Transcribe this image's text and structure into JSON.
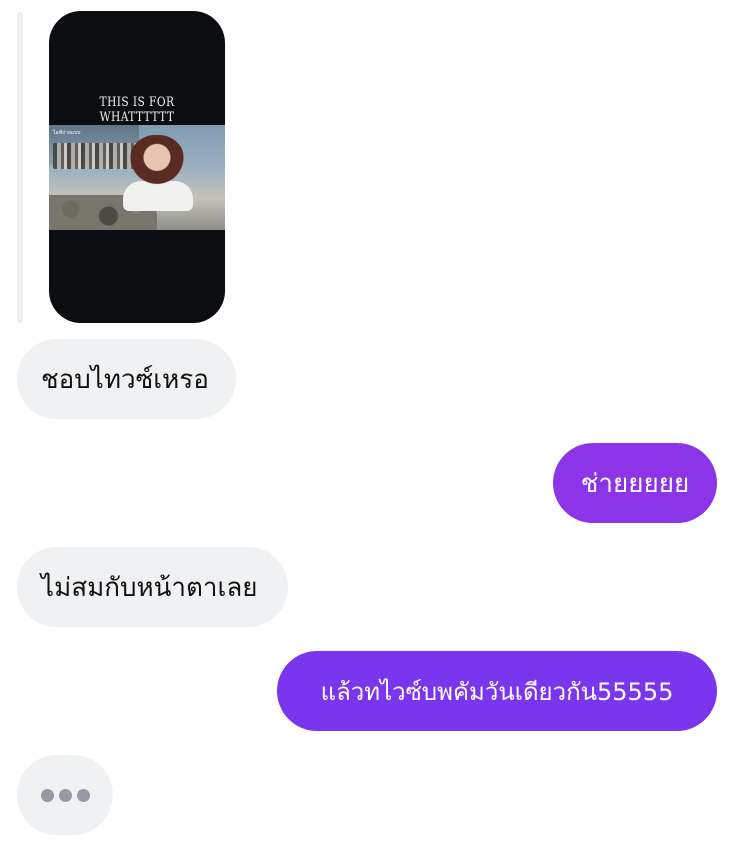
{
  "story_reply": {
    "caption": "THIS IS FOR WHATTTTTT",
    "photo_label": "ไลฟ์ถ่ายแบบ"
  },
  "messages": [
    {
      "side": "incoming",
      "text": "ชอบไทวซ์เหรอ"
    },
    {
      "side": "outgoing",
      "text": "ช่ายยยยย"
    },
    {
      "side": "incoming",
      "text": "ไม่สมกับหน้าตาเลย"
    },
    {
      "side": "outgoing",
      "text": "แล้วทไวซ์บพคัมวันเดียวกัน55555"
    }
  ],
  "typing_indicator": {
    "icon": "typing-dots-icon",
    "dots": 3
  },
  "colors": {
    "incoming_bubble": "#f0f1f3",
    "outgoing_bubble_1": "#8b34e8",
    "outgoing_bubble_2": "#7a35ee",
    "typing_dot": "#969aa3"
  }
}
